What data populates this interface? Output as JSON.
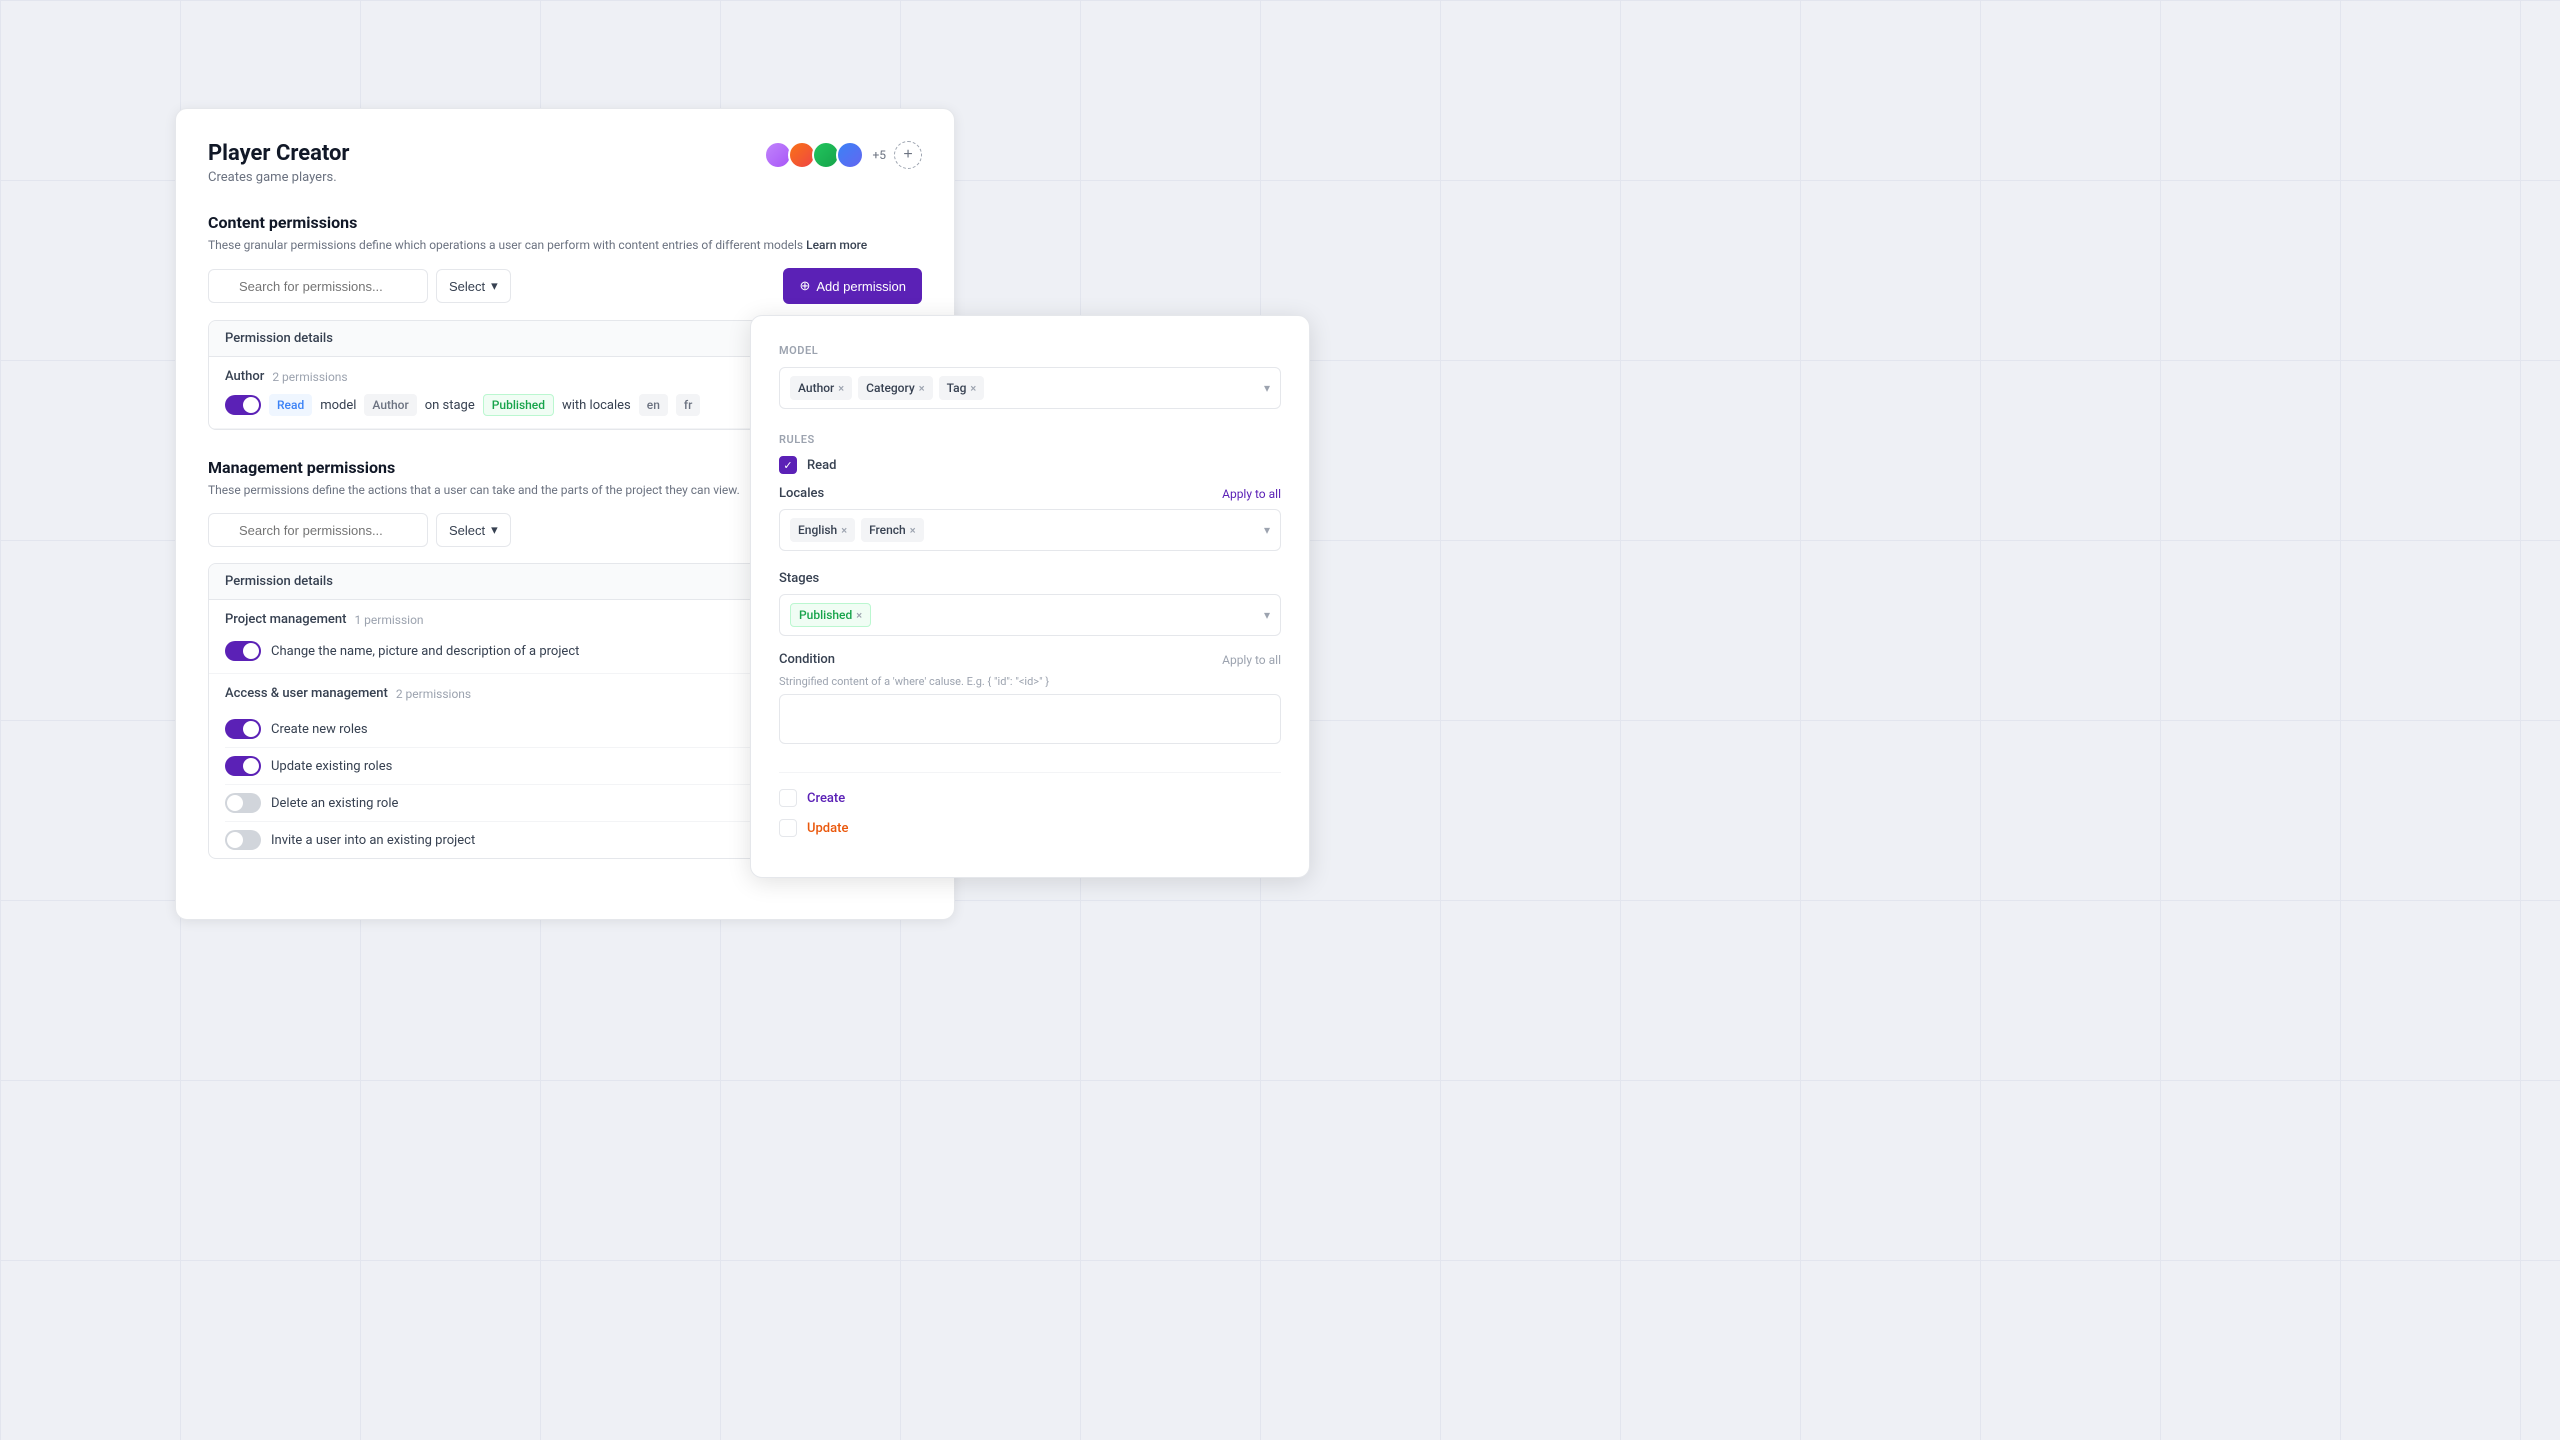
{
  "app": {
    "title": "Player Creator",
    "subtitle": "Creates game players.",
    "avatar_count_extra": "+5"
  },
  "content_permissions": {
    "section_title": "Content permissions",
    "section_desc": "These granular permissions define which operations a user can perform with content entries of different models",
    "learn_more": "Learn more",
    "search_placeholder": "Search for permissions...",
    "select_label": "Select",
    "add_permission_label": "Add permission",
    "panel_header": "Permission details",
    "group_name": "Author",
    "group_count": "2 permissions",
    "rule_action": "Read",
    "rule_model": "model",
    "rule_model_name": "Author",
    "rule_stage_prefix": "on stage",
    "rule_stage": "Published",
    "rule_locales_prefix": "with locales",
    "rule_locale_en": "en",
    "rule_locale_fr": "fr"
  },
  "management_permissions": {
    "section_title": "Management permissions",
    "section_desc": "These permissions define the actions that a user can take and the parts of the project they can view.",
    "search_placeholder": "Search for permissions...",
    "select_label": "Select",
    "panel_header": "Permission details",
    "groups": [
      {
        "name": "Project management",
        "count": "1 permission",
        "items": [
          {
            "label": "Change the name, picture and description of a project",
            "enabled": true
          }
        ]
      },
      {
        "name": "Access & user management",
        "count": "2 permissions",
        "items": [
          {
            "label": "Create new roles",
            "enabled": true
          },
          {
            "label": "Update existing roles",
            "enabled": true
          },
          {
            "label": "Delete an existing role",
            "enabled": false
          },
          {
            "label": "Invite a user into an existing project",
            "enabled": false
          }
        ]
      }
    ]
  },
  "right_panel": {
    "model_label": "Model",
    "model_tags": [
      "Author",
      "Category",
      "Tag"
    ],
    "rules_label": "Rules",
    "read_label": "Read",
    "locales_label": "Locales",
    "apply_to_all_label": "Apply to all",
    "locales": [
      "English",
      "French"
    ],
    "stages_label": "Stages",
    "stages": [
      "Published"
    ],
    "condition_label": "Condition",
    "condition_apply_label": "Apply to all",
    "condition_placeholder": "Stringified content of a 'where' caluse. E.g. { \"id\": \"<id>\" }",
    "create_label": "Create",
    "update_label": "Update"
  }
}
